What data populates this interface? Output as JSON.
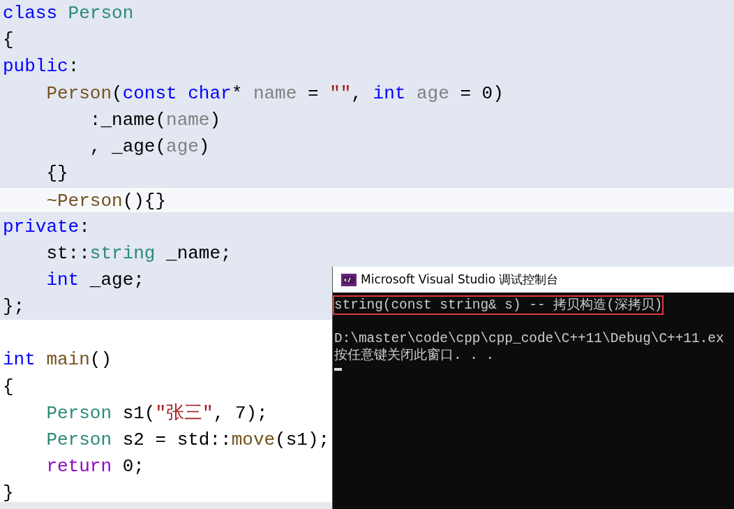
{
  "editor": {
    "lines": [
      {
        "shaded": true,
        "current": false,
        "tokens": [
          {
            "kind": "keyword",
            "text": "class"
          },
          {
            "kind": "type",
            "text": " Person"
          }
        ]
      },
      {
        "shaded": true,
        "current": false,
        "tokens": [
          {
            "kind": "plain",
            "text": "{"
          }
        ]
      },
      {
        "shaded": true,
        "current": false,
        "tokens": [
          {
            "kind": "keyword",
            "text": "public"
          },
          {
            "kind": "plain",
            "text": ":"
          }
        ]
      },
      {
        "shaded": true,
        "current": false,
        "tokens": [
          {
            "kind": "func",
            "text": "    Person"
          },
          {
            "kind": "plain",
            "text": "("
          },
          {
            "kind": "keyword",
            "text": "const char"
          },
          {
            "kind": "plain",
            "text": "* "
          },
          {
            "kind": "param",
            "text": "name"
          },
          {
            "kind": "plain",
            "text": " = "
          },
          {
            "kind": "string",
            "text": "\"\""
          },
          {
            "kind": "plain",
            "text": ", "
          },
          {
            "kind": "keyword",
            "text": "int"
          },
          {
            "kind": "param",
            "text": " age"
          },
          {
            "kind": "plain",
            "text": " = 0)"
          }
        ]
      },
      {
        "shaded": true,
        "current": false,
        "tokens": [
          {
            "kind": "plain",
            "text": "        :_name("
          },
          {
            "kind": "param",
            "text": "name"
          },
          {
            "kind": "plain",
            "text": ")"
          }
        ]
      },
      {
        "shaded": true,
        "current": false,
        "tokens": [
          {
            "kind": "plain",
            "text": "        , _age("
          },
          {
            "kind": "param",
            "text": "age"
          },
          {
            "kind": "plain",
            "text": ")"
          }
        ]
      },
      {
        "shaded": true,
        "current": false,
        "tokens": [
          {
            "kind": "plain",
            "text": "    {}"
          }
        ]
      },
      {
        "shaded": true,
        "current": true,
        "tokens": [
          {
            "kind": "func",
            "text": "    ~Person"
          },
          {
            "kind": "plain",
            "text": "(){}"
          }
        ]
      },
      {
        "shaded": true,
        "current": false,
        "tokens": [
          {
            "kind": "keyword",
            "text": "private"
          },
          {
            "kind": "plain",
            "text": ":"
          }
        ]
      },
      {
        "shaded": true,
        "current": false,
        "tokens": [
          {
            "kind": "plain",
            "text": "    st::"
          },
          {
            "kind": "type",
            "text": "string"
          },
          {
            "kind": "plain",
            "text": " _name;"
          }
        ]
      },
      {
        "shaded": true,
        "current": false,
        "tokens": [
          {
            "kind": "keyword",
            "text": "    int"
          },
          {
            "kind": "plain",
            "text": " _age;"
          }
        ]
      },
      {
        "shaded": true,
        "current": false,
        "tokens": [
          {
            "kind": "plain",
            "text": "};"
          }
        ]
      },
      {
        "shaded": false,
        "current": false
      },
      {
        "shaded": false,
        "current": false,
        "tokens": [
          {
            "kind": "keyword",
            "text": "int"
          },
          {
            "kind": "func",
            "text": " main"
          },
          {
            "kind": "plain",
            "text": "()"
          }
        ]
      },
      {
        "shaded": false,
        "current": false,
        "tokens": [
          {
            "kind": "plain",
            "text": "{"
          }
        ]
      },
      {
        "shaded": false,
        "current": false,
        "tokens": [
          {
            "kind": "type",
            "text": "    Person"
          },
          {
            "kind": "plain",
            "text": " s1("
          },
          {
            "kind": "string",
            "text": "\"张三\""
          },
          {
            "kind": "plain",
            "text": ", 7);"
          }
        ]
      },
      {
        "shaded": false,
        "current": false,
        "tokens": [
          {
            "kind": "type",
            "text": "    Person"
          },
          {
            "kind": "plain",
            "text": " s2 = std::"
          },
          {
            "kind": "func",
            "text": "move"
          },
          {
            "kind": "plain",
            "text": "(s1);"
          }
        ]
      },
      {
        "shaded": false,
        "current": false,
        "tokens": [
          {
            "kind": "control",
            "text": "    return"
          },
          {
            "kind": "plain",
            "text": " 0;"
          }
        ]
      },
      {
        "shaded": false,
        "current": false,
        "tokens": [
          {
            "kind": "plain",
            "text": "}"
          }
        ]
      }
    ]
  },
  "console": {
    "title": "Microsoft Visual Studio 调试控制台",
    "lines": [
      {
        "boxed": true,
        "text": "string(const string& s) -- 拷贝构造(深拷贝)"
      },
      {
        "boxed": false
      },
      {
        "boxed": false,
        "text": "D:\\master\\code\\cpp\\cpp_code\\C++11\\Debug\\C++11.ex"
      },
      {
        "boxed": false,
        "text": "按任意键关闭此窗口. . ."
      }
    ]
  }
}
